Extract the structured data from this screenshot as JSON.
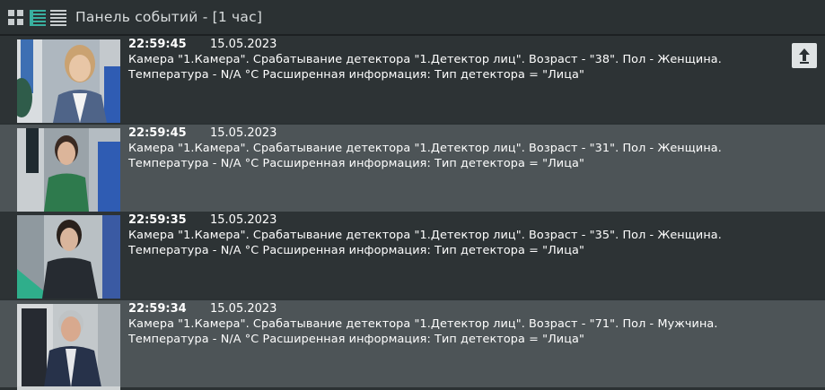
{
  "header": {
    "title": "Панель событий - [1 час]"
  },
  "events": [
    {
      "time": "22:59:45",
      "date": "15.05.2023",
      "line1": "Камера \"1.Камера\". Срабатывание детектора \"1.Детектор лиц\". Возраст - \"38\". Пол - Женщина.",
      "line2": "Температура - N/A °C Расширенная информация: Тип детектора = \"Лица\""
    },
    {
      "time": "22:59:45",
      "date": "15.05.2023",
      "line1": "Камера \"1.Камера\". Срабатывание детектора \"1.Детектор лиц\". Возраст - \"31\". Пол - Женщина.",
      "line2": "Температура - N/A °C Расширенная информация: Тип детектора = \"Лица\""
    },
    {
      "time": "22:59:35",
      "date": "15.05.2023",
      "line1": "Камера \"1.Камера\". Срабатывание детектора \"1.Детектор лиц\". Возраст - \"35\". Пол - Женщина.",
      "line2": "Температура - N/A °C Расширенная информация: Тип детектора = \"Лица\""
    },
    {
      "time": "22:59:34",
      "date": "15.05.2023",
      "line1": "Камера \"1.Камера\". Срабатывание детектора \"1.Детектор лиц\". Возраст - \"71\". Пол - Мужчина.",
      "line2": "Температура - N/A °C Расширенная информация: Тип детектора = \"Лица\""
    }
  ],
  "icons": {
    "view_grid": "grid-view-icon",
    "view_list": "list-view-icon",
    "view_compact": "compact-list-icon",
    "scroll_top": "arrow-up-icon"
  },
  "colors": {
    "background": "#2b3133",
    "row_alt": "#4d5457",
    "accent": "#39b0a0"
  }
}
